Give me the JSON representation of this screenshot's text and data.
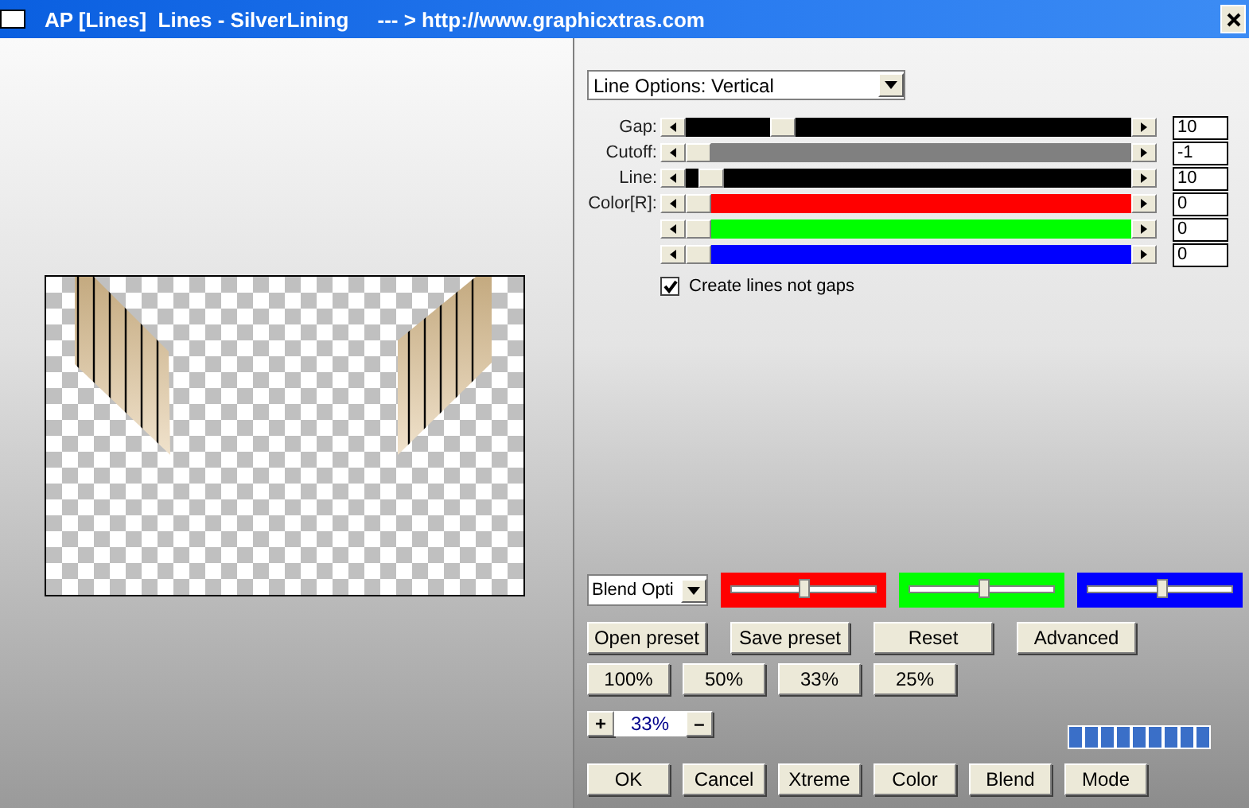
{
  "window": {
    "title": "AP [Lines]  Lines - SilverLining     --- > http://www.graphicxtras.com"
  },
  "line_options": {
    "value": "Line Options: Vertical"
  },
  "sliders": [
    {
      "label": "Gap:",
      "level": 0.2,
      "value": "10",
      "color": "#000000"
    },
    {
      "label": "Cutoff:",
      "level": 0,
      "value": "-1",
      "color": "#808080"
    },
    {
      "label": "Line:",
      "level": 0.03,
      "value": "10",
      "color": "#000000"
    },
    {
      "label": "Color[R]:",
      "level": 0,
      "value": "0",
      "color": "#ff0000"
    },
    {
      "level": 0,
      "value": "0",
      "color": "#00ff00"
    },
    {
      "level": 0,
      "value": "0",
      "color": "#0000ff"
    }
  ],
  "checkbox": {
    "label": "Create lines not gaps",
    "checked": true
  },
  "blend": {
    "dropdown": "Blend Opti",
    "sliders": [
      {
        "color": "#ff0000",
        "level": 0.5
      },
      {
        "color": "#00ff00",
        "level": 0.52
      },
      {
        "color": "#0000ff",
        "level": 0.52
      }
    ]
  },
  "preset_buttons": [
    "Open preset",
    "Save preset",
    "Reset",
    "Advanced"
  ],
  "zoom_buttons": [
    "100%",
    "50%",
    "33%",
    "25%"
  ],
  "zoom": {
    "increase": "+",
    "value": "33%",
    "decrease": "–"
  },
  "progress": {
    "level": 1
  },
  "buttons": [
    "OK",
    "Cancel",
    "Xtreme",
    "Color",
    "Blend",
    "Mode"
  ]
}
